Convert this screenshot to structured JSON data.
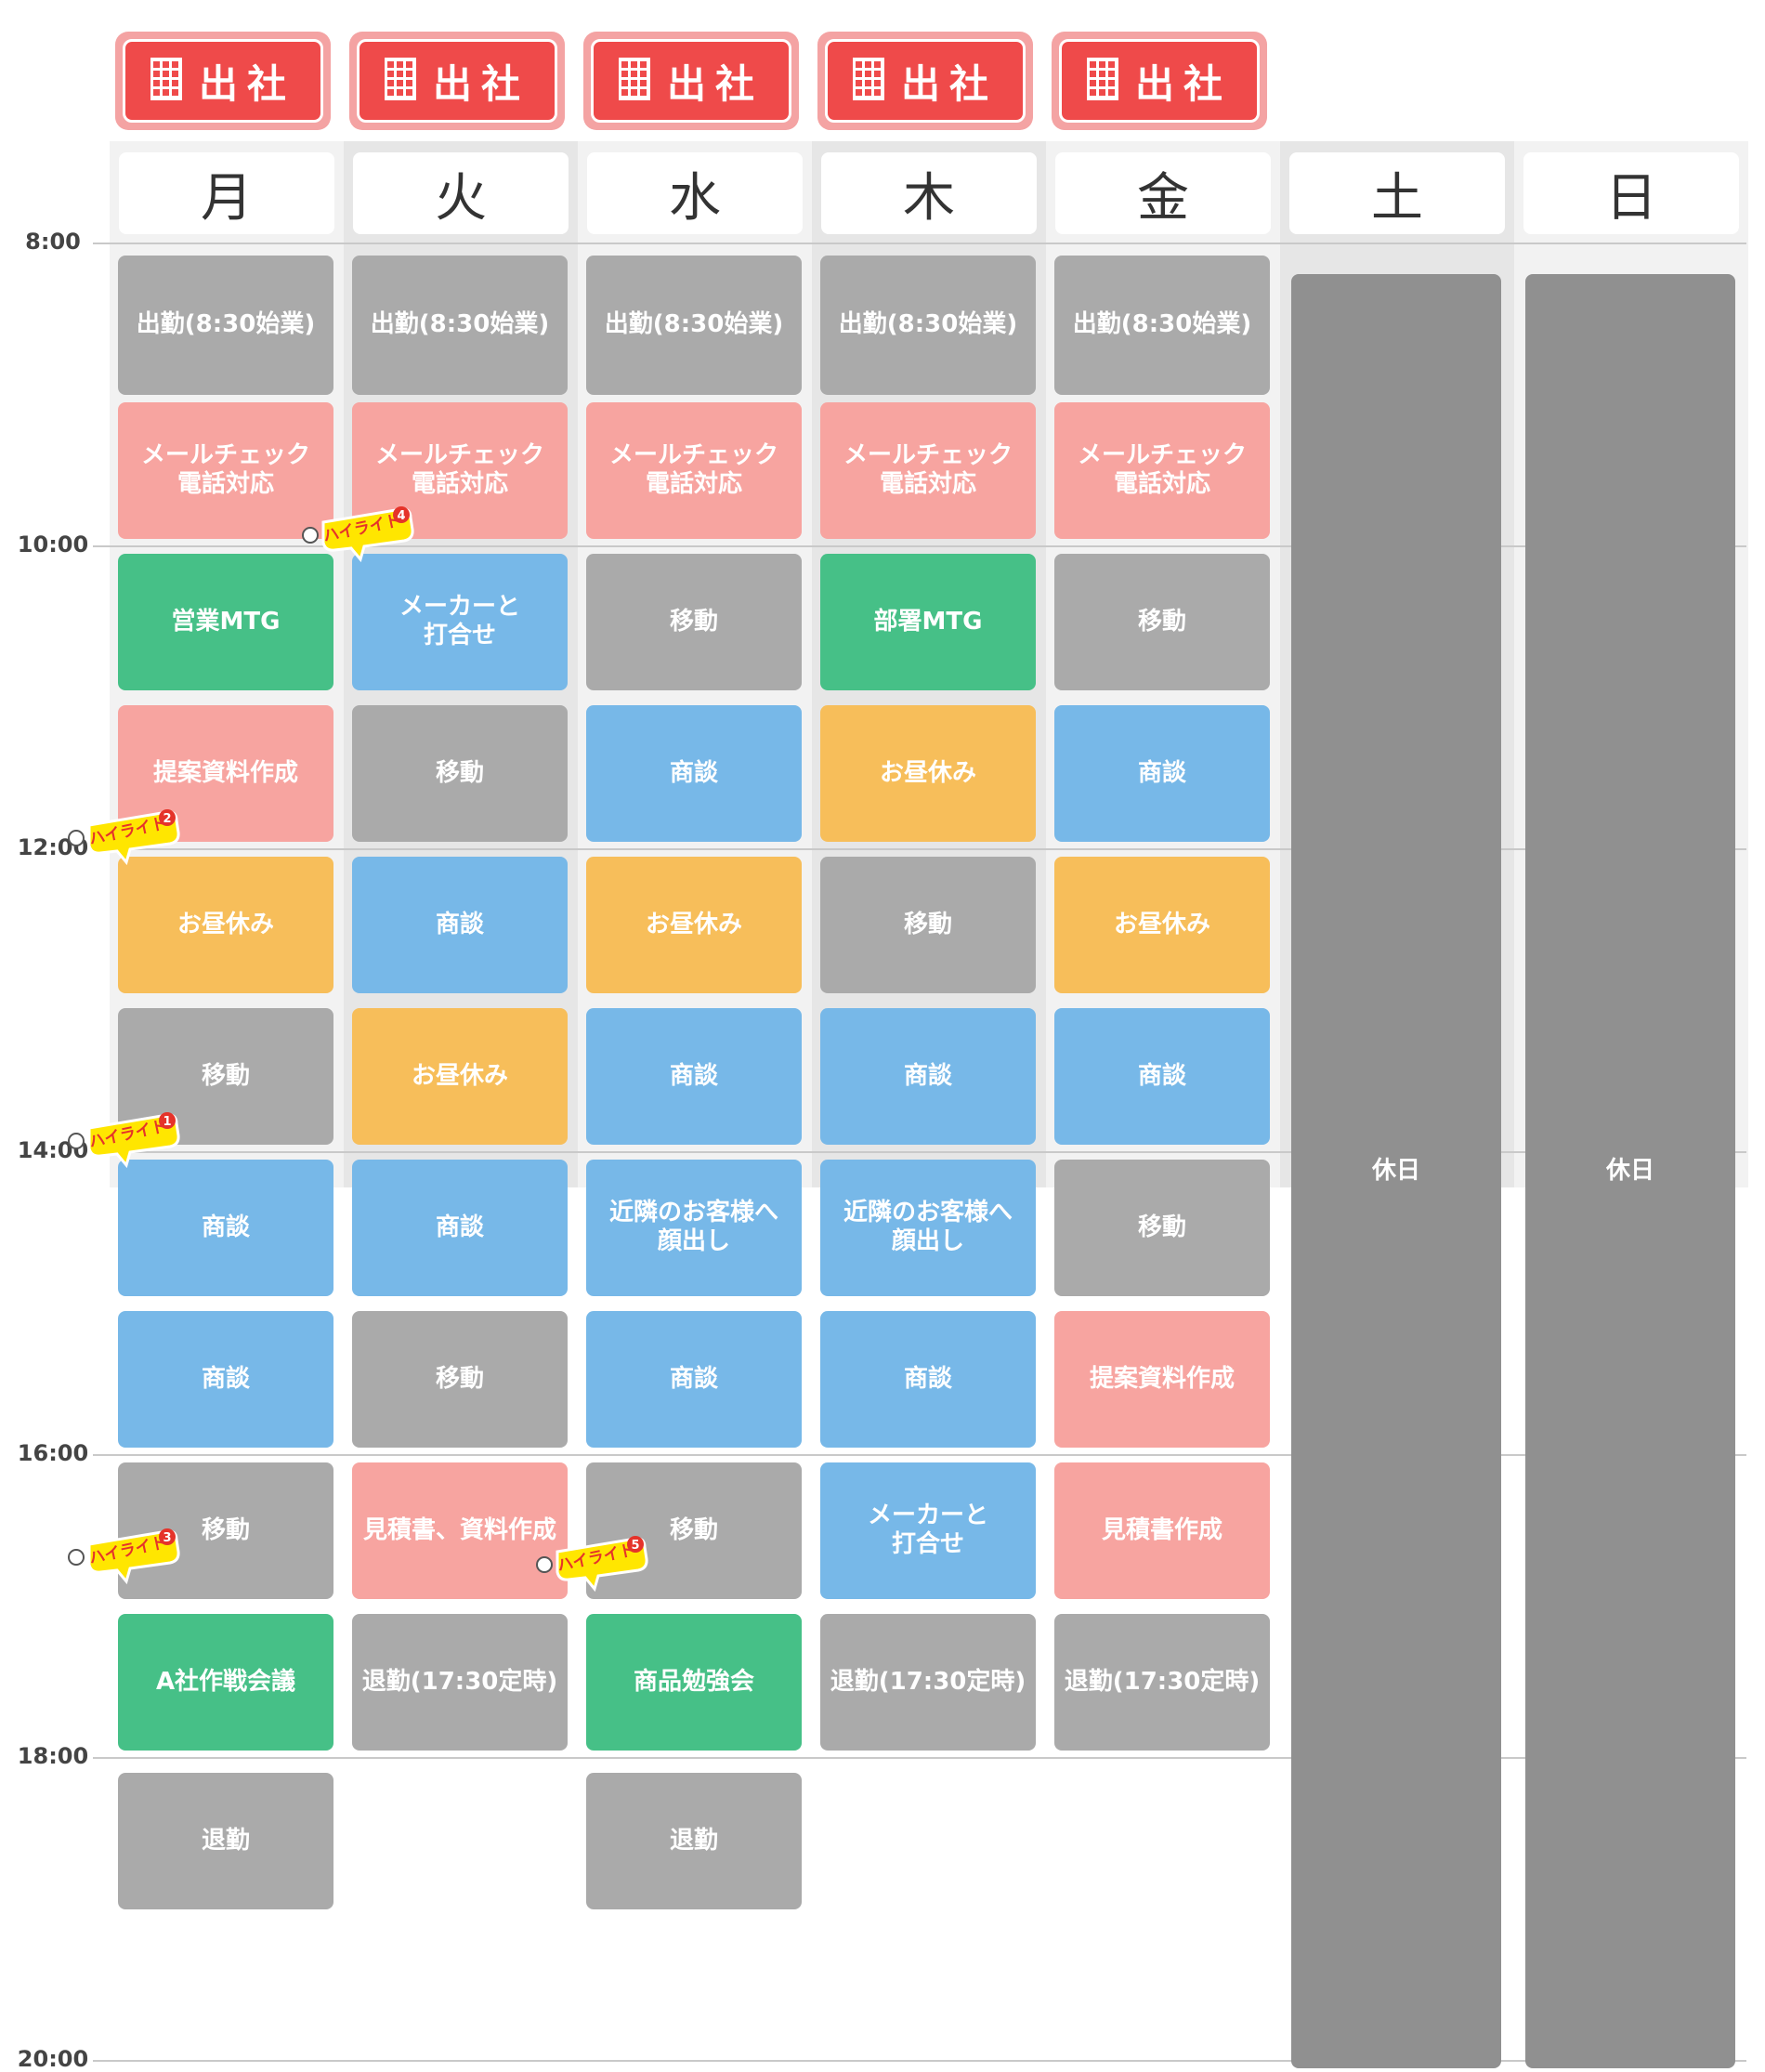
{
  "badges": [
    {
      "icon": "building-icon",
      "label": "出社"
    },
    {
      "icon": "building-icon",
      "label": "出社"
    },
    {
      "icon": "building-icon",
      "label": "出社"
    },
    {
      "icon": "building-icon",
      "label": "出社"
    },
    {
      "icon": "building-icon",
      "label": "出社"
    }
  ],
  "days": [
    "月",
    "火",
    "水",
    "木",
    "金",
    "土",
    "日"
  ],
  "time_labels": [
    "8:00",
    "10:00",
    "12:00",
    "14:00",
    "16:00",
    "18:00",
    "20:00"
  ],
  "colors": {
    "badge_red": "#ef4a4a",
    "gray": "#aaaaaa",
    "pink": "#f7a4a0",
    "green": "#46c087",
    "blue": "#77b8e8",
    "orange": "#f7be5a",
    "holiday": "#909090",
    "highlight_yellow": "#ffe600"
  },
  "events": [
    [
      {
        "label": "出勤(8:30始業)",
        "start": 8.08,
        "end": 9.0,
        "kind": "gray"
      },
      {
        "label": "メールチェック\n電話対応",
        "start": 9.05,
        "end": 9.95,
        "kind": "pink"
      },
      {
        "label": "営業MTG",
        "start": 10.05,
        "end": 10.95,
        "kind": "green"
      },
      {
        "label": "提案資料作成",
        "start": 11.05,
        "end": 11.95,
        "kind": "pink"
      },
      {
        "label": "お昼休み",
        "start": 12.05,
        "end": 12.95,
        "kind": "orange"
      },
      {
        "label": "移動",
        "start": 13.05,
        "end": 13.95,
        "kind": "gray"
      },
      {
        "label": "商談",
        "start": 14.05,
        "end": 14.95,
        "kind": "blue"
      },
      {
        "label": "商談",
        "start": 15.05,
        "end": 15.95,
        "kind": "blue"
      },
      {
        "label": "移動",
        "start": 16.05,
        "end": 16.95,
        "kind": "gray"
      },
      {
        "label": "A社作戦会議",
        "start": 17.05,
        "end": 17.95,
        "kind": "green"
      },
      {
        "label": "退勤",
        "start": 18.1,
        "end": 19.0,
        "kind": "gray"
      }
    ],
    [
      {
        "label": "出勤(8:30始業)",
        "start": 8.08,
        "end": 9.0,
        "kind": "gray"
      },
      {
        "label": "メールチェック\n電話対応",
        "start": 9.05,
        "end": 9.95,
        "kind": "pink"
      },
      {
        "label": "メーカーと\n打合せ",
        "start": 10.05,
        "end": 10.95,
        "kind": "blue"
      },
      {
        "label": "移動",
        "start": 11.05,
        "end": 11.95,
        "kind": "gray"
      },
      {
        "label": "商談",
        "start": 12.05,
        "end": 12.95,
        "kind": "blue"
      },
      {
        "label": "お昼休み",
        "start": 13.05,
        "end": 13.95,
        "kind": "orange"
      },
      {
        "label": "商談",
        "start": 14.05,
        "end": 14.95,
        "kind": "blue"
      },
      {
        "label": "移動",
        "start": 15.05,
        "end": 15.95,
        "kind": "gray"
      },
      {
        "label": "見積書、資料作成",
        "start": 16.05,
        "end": 16.95,
        "kind": "pink"
      },
      {
        "label": "退勤(17:30定時)",
        "start": 17.05,
        "end": 17.95,
        "kind": "gray"
      }
    ],
    [
      {
        "label": "出勤(8:30始業)",
        "start": 8.08,
        "end": 9.0,
        "kind": "gray"
      },
      {
        "label": "メールチェック\n電話対応",
        "start": 9.05,
        "end": 9.95,
        "kind": "pink"
      },
      {
        "label": "移動",
        "start": 10.05,
        "end": 10.95,
        "kind": "gray"
      },
      {
        "label": "商談",
        "start": 11.05,
        "end": 11.95,
        "kind": "blue"
      },
      {
        "label": "お昼休み",
        "start": 12.05,
        "end": 12.95,
        "kind": "orange"
      },
      {
        "label": "商談",
        "start": 13.05,
        "end": 13.95,
        "kind": "blue"
      },
      {
        "label": "近隣のお客様へ\n顔出し",
        "start": 14.05,
        "end": 14.95,
        "kind": "blue"
      },
      {
        "label": "商談",
        "start": 15.05,
        "end": 15.95,
        "kind": "blue"
      },
      {
        "label": "移動",
        "start": 16.05,
        "end": 16.95,
        "kind": "gray"
      },
      {
        "label": "商品勉強会",
        "start": 17.05,
        "end": 17.95,
        "kind": "green"
      },
      {
        "label": "退勤",
        "start": 18.1,
        "end": 19.0,
        "kind": "gray"
      }
    ],
    [
      {
        "label": "出勤(8:30始業)",
        "start": 8.08,
        "end": 9.0,
        "kind": "gray"
      },
      {
        "label": "メールチェック\n電話対応",
        "start": 9.05,
        "end": 9.95,
        "kind": "pink"
      },
      {
        "label": "部署MTG",
        "start": 10.05,
        "end": 10.95,
        "kind": "green"
      },
      {
        "label": "お昼休み",
        "start": 11.05,
        "end": 11.95,
        "kind": "orange"
      },
      {
        "label": "移動",
        "start": 12.05,
        "end": 12.95,
        "kind": "gray"
      },
      {
        "label": "商談",
        "start": 13.05,
        "end": 13.95,
        "kind": "blue"
      },
      {
        "label": "近隣のお客様へ\n顔出し",
        "start": 14.05,
        "end": 14.95,
        "kind": "blue"
      },
      {
        "label": "商談",
        "start": 15.05,
        "end": 15.95,
        "kind": "blue"
      },
      {
        "label": "メーカーと\n打合せ",
        "start": 16.05,
        "end": 16.95,
        "kind": "blue"
      },
      {
        "label": "退勤(17:30定時)",
        "start": 17.05,
        "end": 17.95,
        "kind": "gray"
      }
    ],
    [
      {
        "label": "出勤(8:30始業)",
        "start": 8.08,
        "end": 9.0,
        "kind": "gray"
      },
      {
        "label": "メールチェック\n電話対応",
        "start": 9.05,
        "end": 9.95,
        "kind": "pink"
      },
      {
        "label": "移動",
        "start": 10.05,
        "end": 10.95,
        "kind": "gray"
      },
      {
        "label": "商談",
        "start": 11.05,
        "end": 11.95,
        "kind": "blue"
      },
      {
        "label": "お昼休み",
        "start": 12.05,
        "end": 12.95,
        "kind": "orange"
      },
      {
        "label": "商談",
        "start": 13.05,
        "end": 13.95,
        "kind": "blue"
      },
      {
        "label": "移動",
        "start": 14.05,
        "end": 14.95,
        "kind": "gray"
      },
      {
        "label": "提案資料作成",
        "start": 15.05,
        "end": 15.95,
        "kind": "pink"
      },
      {
        "label": "見積書作成",
        "start": 16.05,
        "end": 16.95,
        "kind": "pink"
      },
      {
        "label": "退勤(17:30定時)",
        "start": 17.05,
        "end": 17.95,
        "kind": "gray"
      }
    ],
    [
      {
        "label": "休日",
        "start": 8.2,
        "end": 20.05,
        "kind": "holiday"
      }
    ],
    [
      {
        "label": "休日",
        "start": 8.2,
        "end": 20.05,
        "kind": "holiday"
      }
    ]
  ],
  "highlights": [
    {
      "label": "ハイライト",
      "number": "1",
      "day": 0,
      "time": 14.0
    },
    {
      "label": "ハイライト",
      "number": "2",
      "day": 0,
      "time": 12.0
    },
    {
      "label": "ハイライト",
      "number": "3",
      "day": 0,
      "time": 16.75
    },
    {
      "label": "ハイライト",
      "number": "4",
      "day": 1,
      "time": 10.0
    },
    {
      "label": "ハイライト",
      "number": "5",
      "day": 2,
      "time": 16.8
    }
  ]
}
